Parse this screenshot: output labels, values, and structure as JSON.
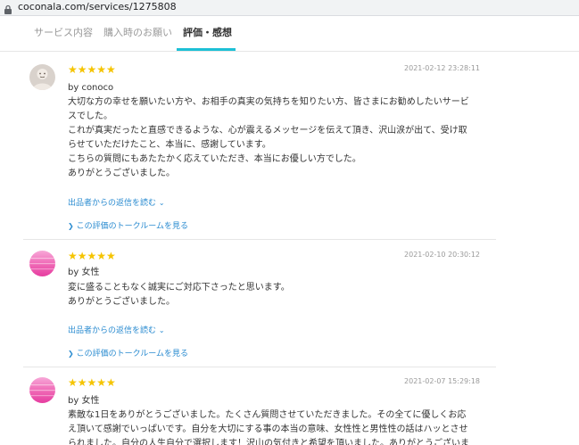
{
  "browser": {
    "url": "coconala.com/services/1275808"
  },
  "tabs": [
    {
      "label": "サービス内容"
    },
    {
      "label": "購入時のお願い"
    },
    {
      "label": "評価・感想"
    }
  ],
  "reviews": [
    {
      "stars": "★★★★★",
      "date": "2021-02-12 23:28:11",
      "author": "by conoco",
      "lines": [
        "大切な方の幸せを願いたい方や、お相手の真実の気持ちを知りたい方、皆さまにお勧めしたいサービ",
        "スでした。",
        "これが真実だったと直感できるような、心が震えるメッセージを伝えて頂き、沢山涙が出て、受け取",
        "らせていただけたこと、本当に、感謝しています。",
        "こちらの質問にもあたたかく応えていただき、本当にお優しい方でした。",
        "ありがとうございました。"
      ],
      "reply_link": "出品者からの返信を読む",
      "talkroom_link": "この評価のトークルームを見る"
    },
    {
      "stars": "★★★★★",
      "date": "2021-02-10 20:30:12",
      "author": "by 女性",
      "lines": [
        "変に盛ることもなく誠実にご対応下さったと思います。",
        "ありがとうございました。"
      ],
      "reply_link": "出品者からの返信を読む",
      "talkroom_link": "この評価のトークルームを見る"
    },
    {
      "stars": "★★★★★",
      "date": "2021-02-07 15:29:18",
      "author": "by 女性",
      "lines": [
        "素敵な1日をありがとうございました。たくさん質問させていただきました。その全てに優しくお応",
        "え頂いて感謝でいっぱいです。自分を大切にする事の本当の意味、女性性と男性性の話はハッとさせ",
        "られました。自分の人生自分で選択します！沢山の気付きと希望を頂いました。ありがとうございま"
      ]
    }
  ],
  "colors": {
    "accent": "#1dc0d6",
    "star": "#f5c400",
    "link": "#2a8bd0",
    "avatar_pink": "#f06bb7"
  }
}
